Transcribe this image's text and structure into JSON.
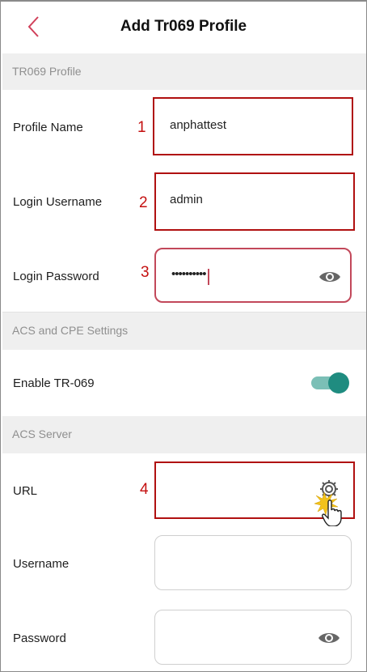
{
  "header": {
    "title": "Add Tr069 Profile",
    "back_icon": "chevron-left-icon"
  },
  "sections": {
    "tr069": "TR069 Profile",
    "acs_cpe": "ACS and CPE Settings",
    "acs_server": "ACS Server"
  },
  "profile": {
    "name_label": "Profile Name",
    "name_value": "anphattest",
    "username_label": "Login Username",
    "username_value": "admin",
    "password_label": "Login Password",
    "password_value": "••••••••••"
  },
  "settings": {
    "enable_label": "Enable TR-069",
    "enabled": true
  },
  "acs": {
    "url_label": "URL",
    "url_value": "",
    "username_label": "Username",
    "username_value": "",
    "password_label": "Password",
    "password_value": ""
  },
  "annotations": [
    "1",
    "2",
    "3",
    "4"
  ],
  "colors": {
    "accent": "#d1405a",
    "toggle_on": "#1f8c80",
    "annotation": "#b01010"
  },
  "icons": [
    "chevron-left-icon",
    "eye-icon",
    "gear-icon",
    "pointer-hand-icon"
  ]
}
